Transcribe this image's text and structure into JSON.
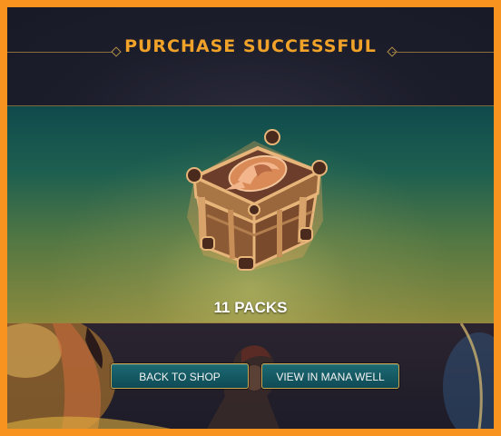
{
  "dialog": {
    "title": "PURCHASE SUCCESSFUL",
    "reward": {
      "icon": "treasure-chest-icon",
      "count_label": "11 PACKS"
    },
    "buttons": {
      "back_label": "BACK TO SHOP",
      "view_label": "VIEW IN MANA WELL"
    }
  },
  "colors": {
    "outer_border": "#f7931e",
    "title_gold": "#f0a229",
    "button_teal": "#0f4a55",
    "button_border": "#c9a54e"
  }
}
